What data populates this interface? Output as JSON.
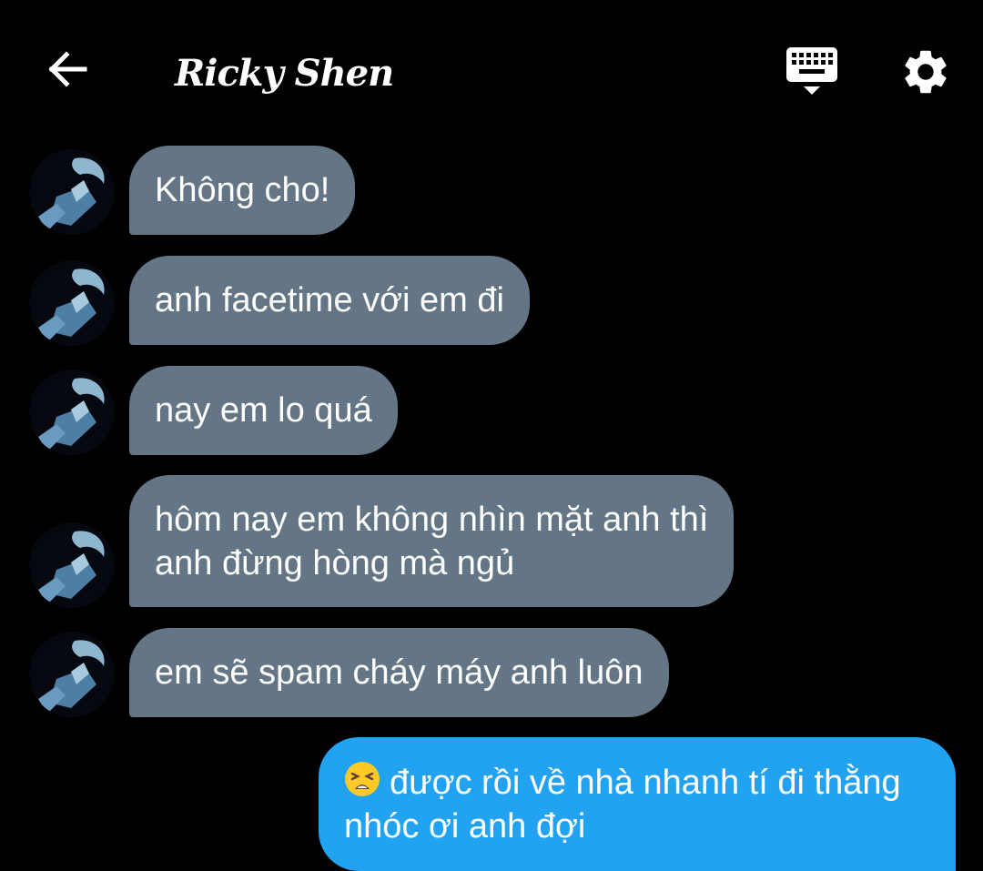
{
  "header": {
    "title": "Ricky Shen",
    "back_icon": "arrow-left-icon",
    "keyboard_icon": "keyboard-icon",
    "settings_icon": "gear-icon"
  },
  "colors": {
    "background": "#000000",
    "incoming_bubble": "#647585",
    "outgoing_bubble": "#21a3f1",
    "text": "#ffffff"
  },
  "messages": [
    {
      "direction": "incoming",
      "text": "Không cho!"
    },
    {
      "direction": "incoming",
      "text": "anh facetime với em đi"
    },
    {
      "direction": "incoming",
      "text": "nay em lo quá"
    },
    {
      "direction": "incoming",
      "lines": [
        "hôm nay em không nhìn mặt anh thì",
        "anh đừng hòng mà ngủ"
      ]
    },
    {
      "direction": "incoming",
      "text": "em sẽ spam cháy máy anh luôn"
    },
    {
      "direction": "outgoing",
      "emoji": "tired-face-emoji",
      "lines": [
        "được rồi về nhà nhanh tí đi thằng",
        "nhóc ơi anh đợi"
      ]
    }
  ]
}
